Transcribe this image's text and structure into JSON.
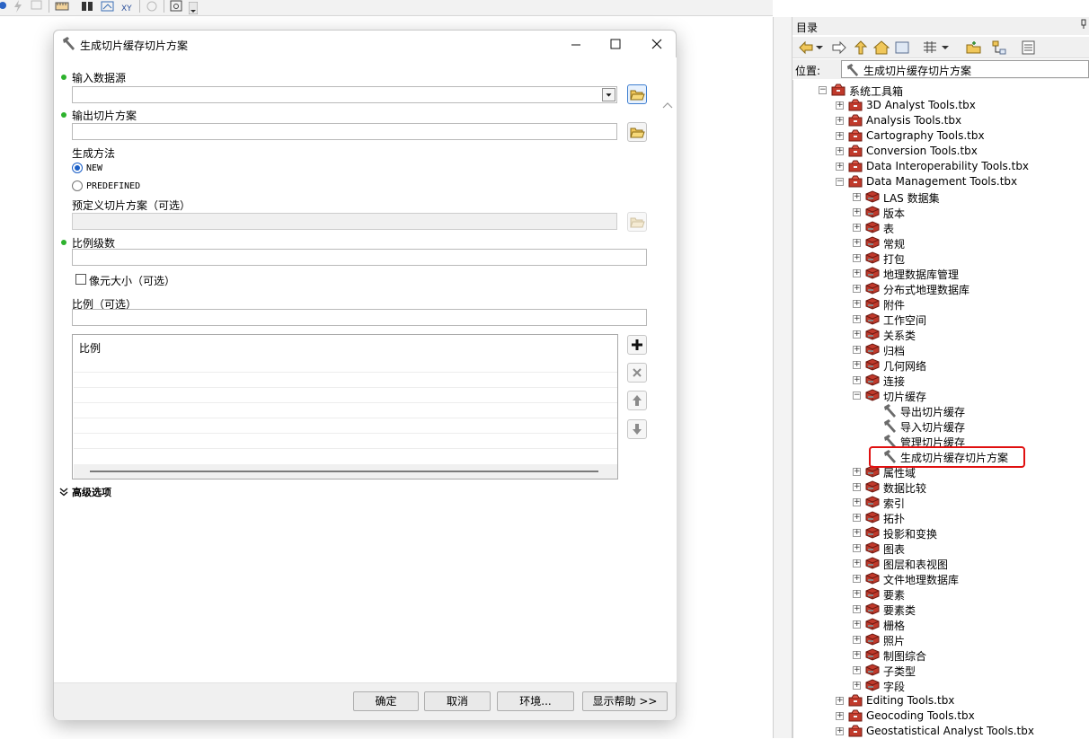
{
  "dialog": {
    "title": "生成切片缓存切片方案",
    "fields": {
      "input_source_label": "输入数据源",
      "input_source_value": "",
      "output_scheme_label": "输出切片方案",
      "output_scheme_value": "",
      "method_label": "生成方法",
      "method_options": [
        "NEW",
        "PREDEFINED"
      ],
      "method_selected": "NEW",
      "predefined_label": "预定义切片方案（可选）",
      "scale_levels_label": "比例级数",
      "scale_levels_value": "",
      "pixel_size_label": "像元大小（可选）",
      "scale_optional_label": "比例（可选）",
      "scale_table_header": "比例",
      "advanced_label": "高级选项"
    },
    "buttons": {
      "ok": "确定",
      "cancel": "取消",
      "env": "环境...",
      "help": "显示帮助 >>"
    }
  },
  "catalog": {
    "title": "目录",
    "location_label": "位置:",
    "location_value": "生成切片缓存切片方案",
    "tree": [
      {
        "label": "系统工具箱",
        "depth": 0,
        "expanded": true,
        "kind": "folder"
      },
      {
        "label": "3D Analyst Tools.tbx",
        "depth": 1,
        "expanded": false,
        "kind": "toolbox"
      },
      {
        "label": "Analysis Tools.tbx",
        "depth": 1,
        "expanded": false,
        "kind": "toolbox"
      },
      {
        "label": "Cartography Tools.tbx",
        "depth": 1,
        "expanded": false,
        "kind": "toolbox"
      },
      {
        "label": "Conversion Tools.tbx",
        "depth": 1,
        "expanded": false,
        "kind": "toolbox"
      },
      {
        "label": "Data Interoperability Tools.tbx",
        "depth": 1,
        "expanded": false,
        "kind": "toolbox"
      },
      {
        "label": "Data Management Tools.tbx",
        "depth": 1,
        "expanded": true,
        "kind": "toolbox"
      },
      {
        "label": "LAS 数据集",
        "depth": 2,
        "expanded": false,
        "kind": "toolset"
      },
      {
        "label": "版本",
        "depth": 2,
        "expanded": false,
        "kind": "toolset"
      },
      {
        "label": "表",
        "depth": 2,
        "expanded": false,
        "kind": "toolset"
      },
      {
        "label": "常规",
        "depth": 2,
        "expanded": false,
        "kind": "toolset"
      },
      {
        "label": "打包",
        "depth": 2,
        "expanded": false,
        "kind": "toolset"
      },
      {
        "label": "地理数据库管理",
        "depth": 2,
        "expanded": false,
        "kind": "toolset"
      },
      {
        "label": "分布式地理数据库",
        "depth": 2,
        "expanded": false,
        "kind": "toolset"
      },
      {
        "label": "附件",
        "depth": 2,
        "expanded": false,
        "kind": "toolset"
      },
      {
        "label": "工作空间",
        "depth": 2,
        "expanded": false,
        "kind": "toolset"
      },
      {
        "label": "关系类",
        "depth": 2,
        "expanded": false,
        "kind": "toolset"
      },
      {
        "label": "归档",
        "depth": 2,
        "expanded": false,
        "kind": "toolset"
      },
      {
        "label": "几何网络",
        "depth": 2,
        "expanded": false,
        "kind": "toolset"
      },
      {
        "label": "连接",
        "depth": 2,
        "expanded": false,
        "kind": "toolset"
      },
      {
        "label": "切片缓存",
        "depth": 2,
        "expanded": true,
        "kind": "toolset"
      },
      {
        "label": "导出切片缓存",
        "depth": 3,
        "kind": "tool"
      },
      {
        "label": "导入切片缓存",
        "depth": 3,
        "kind": "tool"
      },
      {
        "label": "管理切片缓存",
        "depth": 3,
        "kind": "tool"
      },
      {
        "label": "生成切片缓存切片方案",
        "depth": 3,
        "kind": "tool",
        "selected": true
      },
      {
        "label": "属性域",
        "depth": 2,
        "expanded": false,
        "kind": "toolset"
      },
      {
        "label": "数据比较",
        "depth": 2,
        "expanded": false,
        "kind": "toolset"
      },
      {
        "label": "索引",
        "depth": 2,
        "expanded": false,
        "kind": "toolset"
      },
      {
        "label": "拓扑",
        "depth": 2,
        "expanded": false,
        "kind": "toolset"
      },
      {
        "label": "投影和变换",
        "depth": 2,
        "expanded": false,
        "kind": "toolset"
      },
      {
        "label": "图表",
        "depth": 2,
        "expanded": false,
        "kind": "toolset"
      },
      {
        "label": "图层和表视图",
        "depth": 2,
        "expanded": false,
        "kind": "toolset"
      },
      {
        "label": "文件地理数据库",
        "depth": 2,
        "expanded": false,
        "kind": "toolset"
      },
      {
        "label": "要素",
        "depth": 2,
        "expanded": false,
        "kind": "toolset"
      },
      {
        "label": "要素类",
        "depth": 2,
        "expanded": false,
        "kind": "toolset"
      },
      {
        "label": "栅格",
        "depth": 2,
        "expanded": false,
        "kind": "toolset"
      },
      {
        "label": "照片",
        "depth": 2,
        "expanded": false,
        "kind": "toolset"
      },
      {
        "label": "制图综合",
        "depth": 2,
        "expanded": false,
        "kind": "toolset"
      },
      {
        "label": "子类型",
        "depth": 2,
        "expanded": false,
        "kind": "toolset"
      },
      {
        "label": "字段",
        "depth": 2,
        "expanded": false,
        "kind": "toolset"
      },
      {
        "label": "Editing Tools.tbx",
        "depth": 1,
        "expanded": false,
        "kind": "toolbox"
      },
      {
        "label": "Geocoding Tools.tbx",
        "depth": 1,
        "expanded": false,
        "kind": "toolbox"
      },
      {
        "label": "Geostatistical Analyst Tools.tbx",
        "depth": 1,
        "expanded": false,
        "kind": "toolbox"
      }
    ]
  },
  "colors": {
    "required_dot": "#2db22d",
    "highlight": "#e01010",
    "toolbox_red": "#c0392b"
  }
}
